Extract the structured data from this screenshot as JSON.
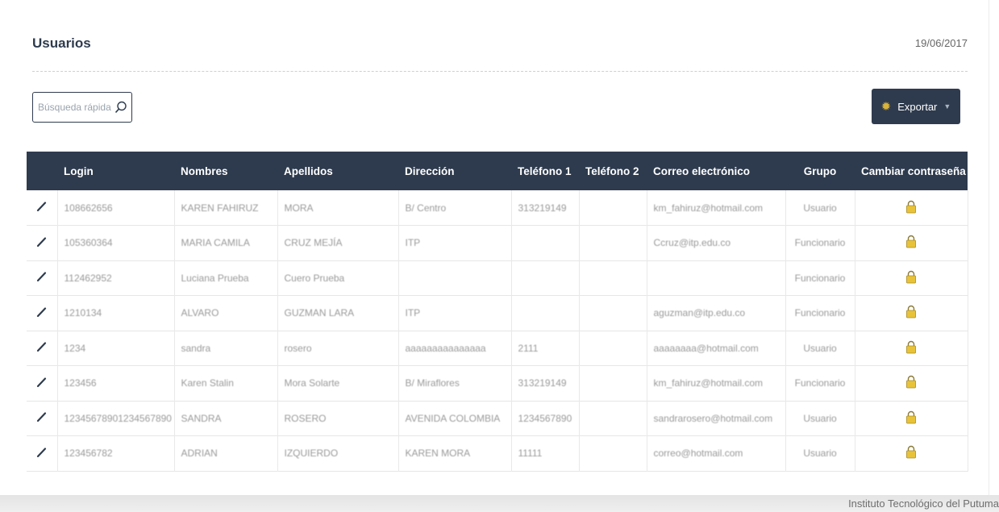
{
  "header": {
    "title": "Usuarios",
    "date": "19/06/2017"
  },
  "search": {
    "placeholder": "Búsqueda rápida",
    "icon": "search-icon"
  },
  "toolbar": {
    "export_label": "Exportar",
    "export_icon": "gear-icon"
  },
  "table": {
    "columns": [
      "Login",
      "Nombres",
      "Apellidos",
      "Dirección",
      "Teléfono 1",
      "Teléfono 2",
      "Correo electrónico",
      "Grupo",
      "Cambiar contraseña"
    ],
    "rows": [
      {
        "login": "108662656",
        "nombres": "KAREN FAHIRUZ",
        "apellidos": "MORA",
        "direccion": "B/ Centro",
        "telefono1": "313219149",
        "telefono2": "",
        "correo": "km_fahiruz@hotmail.com",
        "grupo": "Usuario"
      },
      {
        "login": "105360364",
        "nombres": "MARIA CAMILA",
        "apellidos": "CRUZ MEJÍA",
        "direccion": "ITP",
        "telefono1": "",
        "telefono2": "",
        "correo": "Ccruz@itp.edu.co",
        "grupo": "Funcionario"
      },
      {
        "login": "112462952",
        "nombres": "Luciana Prueba",
        "apellidos": "Cuero Prueba",
        "direccion": "",
        "telefono1": "",
        "telefono2": "",
        "correo": "",
        "grupo": "Funcionario"
      },
      {
        "login": "1210134",
        "nombres": "ALVARO",
        "apellidos": "GUZMAN LARA",
        "direccion": "ITP",
        "telefono1": "",
        "telefono2": "",
        "correo": "aguzman@itp.edu.co",
        "grupo": "Funcionario"
      },
      {
        "login": "1234",
        "nombres": "sandra",
        "apellidos": "rosero",
        "direccion": "aaaaaaaaaaaaaaa",
        "telefono1": "2111",
        "telefono2": "",
        "correo": "aaaaaaaa@hotmail.com",
        "grupo": "Usuario"
      },
      {
        "login": "123456",
        "nombres": "Karen Stalin",
        "apellidos": "Mora Solarte",
        "direccion": "B/ Miraflores",
        "telefono1": "313219149",
        "telefono2": "",
        "correo": "km_fahiruz@hotmail.com",
        "grupo": "Funcionario"
      },
      {
        "login": "12345678901234567890",
        "nombres": "SANDRA",
        "apellidos": "ROSERO",
        "direccion": "AVENIDA COLOMBIA",
        "telefono1": "1234567890",
        "telefono2": "",
        "correo": "sandrarosero@hotmail.com",
        "grupo": "Usuario"
      },
      {
        "login": "123456782",
        "nombres": "ADRIAN",
        "apellidos": "IZQUIERDO",
        "direccion": "KAREN MORA",
        "telefono1": "11111",
        "telefono2": "",
        "correo": "correo@hotmail.com",
        "grupo": "Usuario"
      }
    ]
  },
  "footer": {
    "text": "Instituto Tecnológico del Putuma"
  },
  "colors": {
    "header_bg": "#2e3b4e",
    "accent_icon": "#d9b43a",
    "edit_icon": "#2e3b4e"
  }
}
